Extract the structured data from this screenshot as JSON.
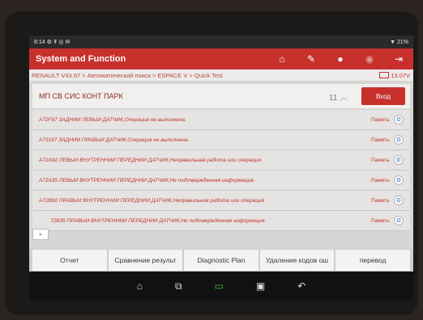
{
  "status_bar": {
    "time": "8:14",
    "icons": "⚙ ☤ ◎ ✉",
    "battery": "▼ 21%"
  },
  "header": {
    "title": "System and Function"
  },
  "breadcrumb": {
    "path": "RENAULT V43.97 > Автоматический поиск > ESPACE V > Quick Test",
    "voltage": "13.07V"
  },
  "system": {
    "name": "МП СВ СИС КОНТ ПАРК",
    "count": "11",
    "enter_label": "Вход"
  },
  "codes": [
    {
      "text": "A72F97 ЗАДНИЙ ЛЕВЫЙ ДАТЧИК,Операция не выполнена.",
      "mem": "Память"
    },
    {
      "text": "A73197 ЗАДНИЙ ПРАВЫЙ ДАТЧИК,Операция не выполнена.",
      "mem": "Память"
    },
    {
      "text": "A72A92 ЛЕВЫЙ ВНУТРЕННИЙ ПЕРЕДНИЙ ДАТЧИК,Неправильная работа или операция",
      "mem": "Память"
    },
    {
      "text": "A72A35 ЛЕВЫЙ ВНУТРЕННИЙ ПЕРЕДНИЙ ДАТЧИК,Не подтвержденная информация.",
      "mem": "Память"
    },
    {
      "text": "A72B92 ПРАВЫЙ ВНУТРЕННИЙ ПЕРЕДНИЙ ДАТЧИК,Неправильная работа или операция",
      "mem": "Память"
    },
    {
      "text": "72B35 ПРАВЫЙ ВНУТРЕННИЙ ПЕРЕДНИЙ ДАТЧИК,Не подтвержденная информация.",
      "mem": "Память"
    }
  ],
  "expand_label": "»",
  "bottom_buttons": [
    "Отчет",
    "Сравнение результ",
    "Diagnostic Plan",
    "Удаление кодов ош",
    "перевод"
  ],
  "nav": {
    "home": "⌂",
    "recent": "⧉",
    "vci": "▭",
    "screenshot": "▣",
    "back": "↶"
  }
}
